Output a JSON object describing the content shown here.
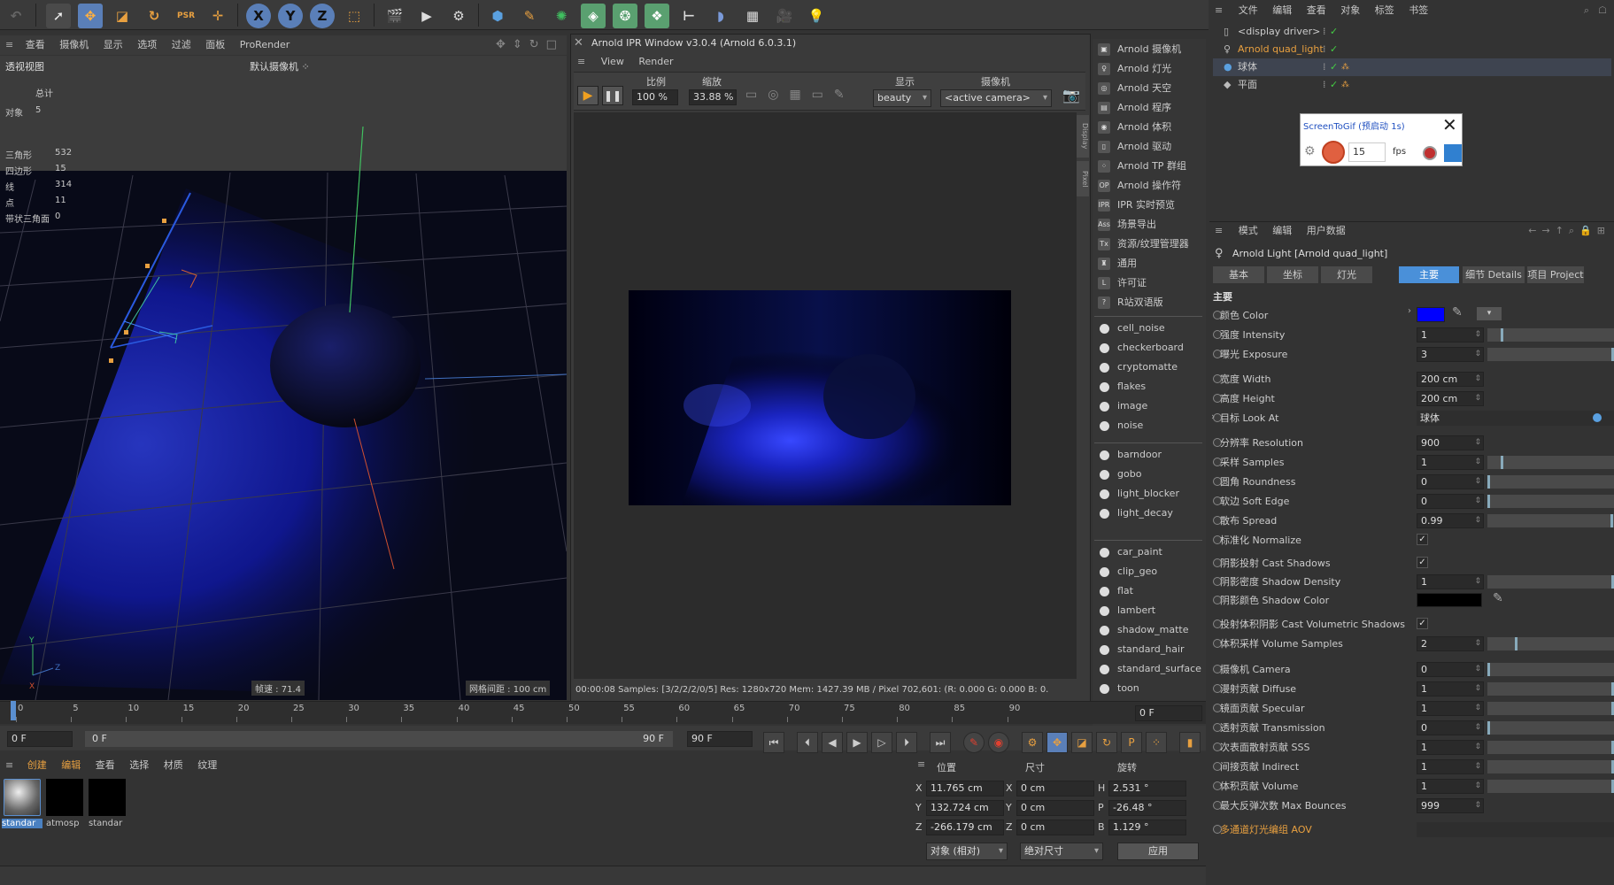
{
  "top_menu": [
    "文件",
    "编辑",
    "查看",
    "对象",
    "标签",
    "书签"
  ],
  "viewport": {
    "menu": [
      "查看",
      "摄像机",
      "显示",
      "选项",
      "过滤",
      "面板",
      "ProRender"
    ],
    "name": "透视视图",
    "camera": "默认摄像机",
    "stats": {
      "header": "总计",
      "rows": [
        [
          "对象",
          "5"
        ],
        [
          "三角形",
          "532"
        ],
        [
          "四边形",
          "15"
        ],
        [
          "线",
          "314"
        ],
        [
          "点",
          "11"
        ],
        [
          "带状三角面",
          "0"
        ]
      ]
    },
    "speed": "帧速 : 71.4",
    "grid": "网格间距 : 100 cm"
  },
  "ipr": {
    "title": "Arnold IPR Window v3.0.4 (Arnold 6.0.3.1)",
    "menu": [
      "View",
      "Render"
    ],
    "labels": {
      "scale": "比例",
      "zoom": "缩放",
      "display": "显示",
      "camera": "摄像机"
    },
    "scale_value": "100 %",
    "zoom_value": "33.88 %",
    "display_value": "beauty",
    "camera_value": "<active camera>",
    "side_tabs": [
      "Display",
      "Pixel"
    ],
    "status": "00:00:08  Samples: [3/2/2/2/0/5]  Res: 1280x720  Mem: 1427.39 MB / Pixel 702,601: (R: 0.000 G: 0.000 B: 0."
  },
  "arnold_menu": [
    {
      "label": "Arnold 摄像机",
      "icon": "camera-icon",
      "g": "▣"
    },
    {
      "label": "Arnold 灯光",
      "icon": "bulb-icon",
      "g": "♀"
    },
    {
      "label": "Arnold 天空",
      "icon": "sky-icon",
      "g": "◎"
    },
    {
      "label": "Arnold 程序",
      "icon": "procedural-icon",
      "g": "▤"
    },
    {
      "label": "Arnold 体积",
      "icon": "volume-icon",
      "g": "◉"
    },
    {
      "label": "Arnold 驱动",
      "icon": "driver-icon",
      "g": "▯"
    },
    {
      "label": "Arnold TP 群组",
      "icon": "tp-group-icon",
      "g": "⁘"
    },
    {
      "label": "Arnold 操作符",
      "icon": "operator-icon",
      "g": "OP"
    },
    {
      "label": "IPR 实时预览",
      "icon": "ipr-icon",
      "g": "IPR"
    },
    {
      "label": "场景导出",
      "icon": "scene-export-icon",
      "g": "Ass"
    },
    {
      "label": "资源/纹理管理器",
      "icon": "texture-manager-icon",
      "g": "Tx"
    },
    {
      "label": "通用",
      "icon": "utility-icon",
      "g": "♜"
    },
    {
      "label": "许可证",
      "icon": "license-icon",
      "g": "L"
    },
    {
      "label": "R站双语版",
      "icon": "help-icon",
      "g": "?"
    }
  ],
  "shader_groups": [
    [
      "cell_noise",
      "checkerboard",
      "cryptomatte",
      "flakes",
      "image",
      "noise"
    ],
    [
      "barndoor",
      "gobo",
      "light_blocker",
      "light_decay"
    ],
    [
      "car_paint",
      "clip_geo",
      "flat",
      "lambert",
      "shadow_matte",
      "standard_hair",
      "standard_surface",
      "toon"
    ]
  ],
  "objects": [
    {
      "name": "<display driver>",
      "icon": "driver-icon"
    },
    {
      "name": "Arnold quad_light",
      "icon": "bulb-icon",
      "active": true
    },
    {
      "name": "球体",
      "icon": "sphere-icon",
      "selected": true
    },
    {
      "name": "平面",
      "icon": "plane-icon"
    }
  ],
  "screentogif": {
    "title": "ScreenToGif (预启动 1s)",
    "fps_value": "15",
    "fps_unit": "fps"
  },
  "attr": {
    "menu": [
      "模式",
      "编辑",
      "用户数据"
    ],
    "title": "Arnold Light [Arnold quad_light]",
    "tabs": [
      "基本",
      "坐标",
      "灯光",
      "主要",
      "细节 Details",
      "项目 Project"
    ],
    "active_tab": "主要",
    "section": "主要",
    "color": {
      "label": "颜色 Color",
      "value": "#0000ff"
    },
    "rows": [
      {
        "label": "强度 Intensity",
        "value": "1",
        "slider": 0.11
      },
      {
        "label": "曝光 Exposure",
        "value": "3",
        "slider": 1.0
      },
      {
        "label": "宽度 Width",
        "value": "200 cm"
      },
      {
        "label": "高度 Height",
        "value": "200 cm"
      },
      {
        "label": "目标 Look At",
        "value": "球体"
      },
      {
        "label": "分辨率 Resolution",
        "value": "900"
      },
      {
        "label": "采样 Samples",
        "value": "1",
        "slider": 0.11
      },
      {
        "label": "圆角 Roundness",
        "value": "0",
        "slider": 0.0
      },
      {
        "label": "软边 Soft Edge",
        "value": "0",
        "slider": 0.0
      },
      {
        "label": "散布 Spread",
        "value": "0.99",
        "slider": 0.99
      },
      {
        "label": "标准化 Normalize",
        "check": true
      },
      {
        "label": "阴影投射 Cast Shadows",
        "check": true
      },
      {
        "label": "阴影密度 Shadow Density",
        "value": "1",
        "slider": 1.0
      },
      {
        "label": "阴影颜色 Shadow Color",
        "color": "#000000"
      },
      {
        "label": "投射体积阴影 Cast Volumetric Shadows",
        "check": true
      },
      {
        "label": "体积采样 Volume Samples",
        "value": "2",
        "slider": 0.22
      },
      {
        "label": "摄像机 Camera",
        "value": "0",
        "slider": 0.0
      },
      {
        "label": "漫射贡献 Diffuse",
        "value": "1",
        "slider": 1.0
      },
      {
        "label": "镜面贡献 Specular",
        "value": "1",
        "slider": 1.0
      },
      {
        "label": "透射贡献 Transmission",
        "value": "0",
        "slider": 0.0
      },
      {
        "label": "次表面散射贡献 SSS",
        "value": "1",
        "slider": 1.0
      },
      {
        "label": "间接贡献 Indirect",
        "value": "1",
        "slider": 1.0
      },
      {
        "label": "体积贡献 Volume",
        "value": "1",
        "slider": 1.0
      },
      {
        "label": "最大反弹次数 Max Bounces",
        "value": "999"
      }
    ],
    "aov": "多通道灯光编组 AOV"
  },
  "timeline": {
    "ticks": [
      "0",
      "5",
      "10",
      "15",
      "20",
      "25",
      "30",
      "35",
      "40",
      "45",
      "50",
      "55",
      "60",
      "65",
      "70",
      "75",
      "80",
      "85",
      "90"
    ],
    "current": "0 F",
    "start": "0 F",
    "range_start": "0 F",
    "range_end": "90 F",
    "end": "90 F"
  },
  "materials": {
    "menu": [
      "创建",
      "编辑",
      "查看",
      "选择",
      "材质",
      "纹理"
    ],
    "items": [
      "standar",
      "atmosp",
      "standar"
    ]
  },
  "coords": {
    "headers": [
      "位置",
      "尺寸",
      "旋转"
    ],
    "pos": [
      [
        "X",
        "11.765 cm"
      ],
      [
        "Y",
        "132.724 cm"
      ],
      [
        "Z",
        "-266.179 cm"
      ]
    ],
    "size": [
      [
        "X",
        "0 cm"
      ],
      [
        "Y",
        "0 cm"
      ],
      [
        "Z",
        "0 cm"
      ]
    ],
    "rot": [
      [
        "H",
        "2.531 °"
      ],
      [
        "P",
        "-26.48 °"
      ],
      [
        "B",
        "1.129 °"
      ]
    ],
    "mode": "对象 (相对)",
    "size_mode": "绝对尺寸",
    "apply": "应用"
  },
  "colors": {
    "accent": "#4a90d9",
    "active_orange": "#e8a040",
    "light_blue": "#0000ff"
  }
}
